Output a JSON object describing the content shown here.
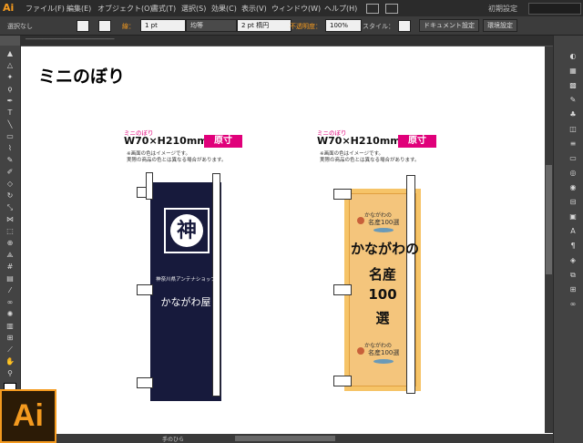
{
  "app": {
    "logo_small": "Ai",
    "logo_big": "Ai"
  },
  "menubar": {
    "items": [
      "ファイル(F)",
      "編集(E)",
      "オブジェクト(O)",
      "書式(T)",
      "選択(S)",
      "効果(C)",
      "表示(V)",
      "ウィンドウ(W)",
      "ヘルプ(H)"
    ],
    "workspace": "初期設定"
  },
  "control_bar": {
    "selection": "選択なし",
    "stroke_label": "線：",
    "stroke_weight": "1 pt",
    "stroke_style": "均等",
    "brush": "2 pt 楕円",
    "opacity_label": "不透明度：",
    "opacity": "100%",
    "style_label": "スタイル：",
    "doc_settings": "ドキュメント設定",
    "env_settings": "環境設定"
  },
  "artboard": {
    "heading": "ミニのぼり",
    "spec_left": {
      "small": "ミニのぼり",
      "size": "W70×H210mm",
      "badge": "原寸",
      "note1": "※画面の色はイメージです。",
      "note2": "実際の商品の色とは異なる場合があります。"
    },
    "spec_right": {
      "small": "ミニのぼり",
      "size": "W70×H210mm",
      "badge": "原寸",
      "note1": "※画面の色はイメージです。",
      "note2": "実際の商品の色とは異なる場合があります。"
    },
    "banner_navy": {
      "emblem": "神",
      "small_text": "神奈川県アンテナショップ",
      "main_text": "かながわ屋"
    },
    "banner_yellow": {
      "pin_top": "名産100選",
      "pin_top_small": "かながわの",
      "line1": "かながわの",
      "line2": "名産",
      "line3": "100",
      "line4": "選",
      "pin_bottom": "名産100選",
      "pin_bottom_small": "かながわの"
    }
  },
  "statusbar": {
    "zoom": "",
    "tool": "手のひら"
  },
  "colors": {
    "accent": "#f49a1f",
    "magenta": "#e0007a",
    "navy": "#171a3c",
    "yellow": "#f4c57c"
  }
}
